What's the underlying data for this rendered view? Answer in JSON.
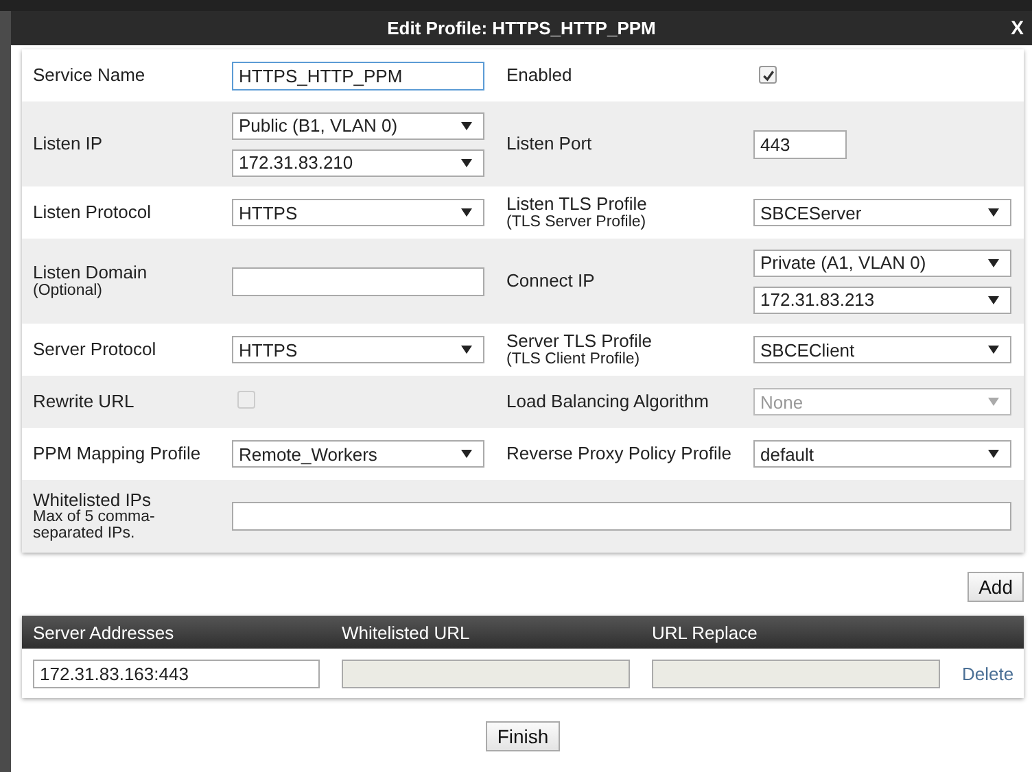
{
  "dialog": {
    "title": "Edit Profile: HTTPS_HTTP_PPM",
    "close": "X"
  },
  "form_rows": [
    {
      "left": {
        "label": "Service Name",
        "kind": "text",
        "value": "HTTPS_HTTP_PPM",
        "focused": true
      },
      "right": {
        "label": "Enabled",
        "kind": "checkbox",
        "checked": true,
        "disabled": false
      }
    },
    {
      "left": {
        "label": "Listen IP",
        "kind": "selects",
        "values": [
          "Public (B1, VLAN 0)",
          "172.31.83.210"
        ]
      },
      "right": {
        "label": "Listen Port",
        "kind": "short_text",
        "value": "443"
      }
    },
    {
      "left": {
        "label": "Listen Protocol",
        "kind": "select",
        "value": "HTTPS"
      },
      "right": {
        "label": "Listen TLS Profile",
        "note": "(TLS Server Profile)",
        "kind": "select",
        "value": "SBCEServer"
      }
    },
    {
      "left": {
        "label": "Listen Domain",
        "note": "(Optional)",
        "kind": "text"
      },
      "right": {
        "label": "Connect IP",
        "kind": "selects",
        "values": [
          "Private (A1, VLAN 0)",
          "172.31.83.213"
        ]
      }
    },
    {
      "left": {
        "label": "Server Protocol",
        "kind": "select",
        "value": "HTTPS"
      },
      "right": {
        "label": "Server TLS Profile",
        "note": "(TLS Client Profile)",
        "kind": "select",
        "value": "SBCEClient"
      }
    },
    {
      "left": {
        "label": "Rewrite URL",
        "kind": "checkbox",
        "checked": false,
        "disabled": true
      },
      "right": {
        "label": "Load Balancing Algorithm",
        "kind": "select",
        "value": "None",
        "disabled": true
      }
    },
    {
      "left": {
        "label": "PPM Mapping Profile",
        "kind": "select",
        "value": "Remote_Workers"
      },
      "right": {
        "label": "Reverse Proxy Policy Profile",
        "kind": "select",
        "value": "default"
      }
    },
    {
      "left": {
        "label": "Whitelisted IPs",
        "note": "Max of 5 comma-separated IPs.",
        "kind": "wide_text"
      }
    }
  ],
  "add_button": "Add",
  "table": {
    "columns": [
      "Server Addresses",
      "Whitelisted URL",
      "URL Replace"
    ],
    "rows": [
      {
        "server_address": "172.31.83.163:443",
        "whitelisted_url_disabled": true,
        "url_replace_disabled": true,
        "action": "Delete"
      }
    ]
  },
  "finish_button": "Finish"
}
